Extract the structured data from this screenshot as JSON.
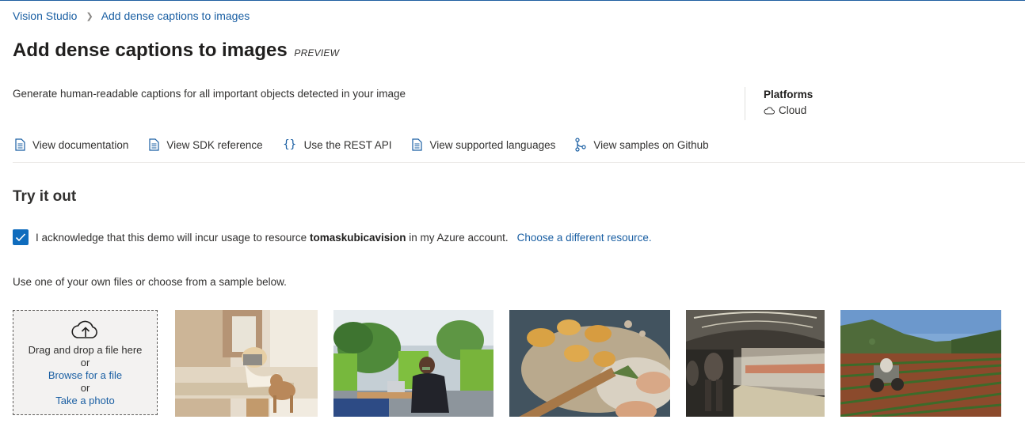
{
  "breadcrumb": {
    "root": "Vision Studio",
    "current": "Add dense captions to images"
  },
  "page": {
    "title": "Add dense captions to images",
    "badge": "PREVIEW"
  },
  "description": "Generate human-readable captions for all important objects detected in your image",
  "platforms": {
    "header": "Platforms",
    "value": "Cloud",
    "icon": "cloud-icon"
  },
  "resource_links": [
    {
      "label": "View documentation",
      "icon": "document-icon"
    },
    {
      "label": "View SDK reference",
      "icon": "document-icon"
    },
    {
      "label": "Use the REST API",
      "icon": "braces-icon"
    },
    {
      "label": "View supported languages",
      "icon": "document-icon"
    },
    {
      "label": "View samples on Github",
      "icon": "branch-icon"
    }
  ],
  "try_it": {
    "title": "Try it out",
    "ack_checked": true,
    "ack_prefix": "I acknowledge that this demo will incur usage to resource",
    "resource_name": "tomaskubicavision",
    "ack_suffix": "in my Azure account.",
    "change_link": "Choose a different resource."
  },
  "instructions": "Use one of your own files or choose from a sample below.",
  "dropzone": {
    "icon": "upload-cloud-icon",
    "drag_text": "Drag and drop a file here",
    "or_1": "or",
    "browse": "Browse for a file",
    "or_2": "or",
    "photo": "Take a photo"
  },
  "samples": [
    {
      "subject": "woman-with-dog-on-bed"
    },
    {
      "subject": "woman-on-laptop-office"
    },
    {
      "subject": "pasta-making"
    },
    {
      "subject": "subway-station"
    },
    {
      "subject": "tractor-in-field"
    }
  ],
  "colors": {
    "accent": "#0f6cbd",
    "link": "#1a5fa3",
    "text": "#323130"
  }
}
